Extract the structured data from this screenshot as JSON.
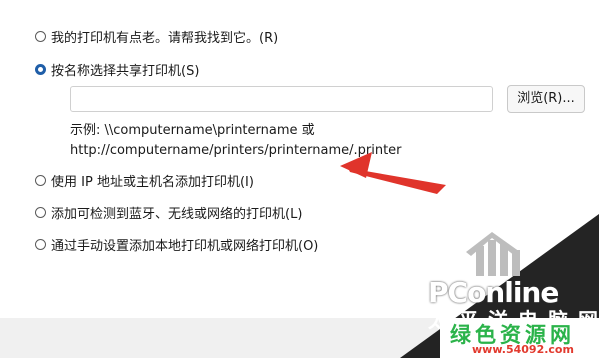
{
  "options": [
    {
      "label": "我的打印机有点老。请帮我找到它。(R)",
      "selected": false
    },
    {
      "label": "按名称选择共享打印机(S)",
      "selected": true
    },
    {
      "label": "使用 IP 地址或主机名添加打印机(I)",
      "selected": false
    },
    {
      "label": "添加可检测到蓝牙、无线或网络的打印机(L)",
      "selected": false
    },
    {
      "label": "通过手动设置添加本地打印机或网络打印机(O)",
      "selected": false
    }
  ],
  "shared_printer": {
    "input_value": "",
    "browse_label": "浏览(R)...",
    "example_line1": "示例: \\\\computername\\printername 或",
    "example_line2": "http://computername/printers/printername/.printer"
  },
  "watermark": {
    "brand": "PConline",
    "cn_line1": "太平洋电脑网",
    "cn_line2": "绿色资源网",
    "url": "www.54092.com"
  },
  "colors": {
    "radio_selected": "#1f5ea8",
    "annotation_arrow": "#e0342b",
    "watermark_green": "#2bb34a",
    "watermark_red": "#e23a2e"
  }
}
